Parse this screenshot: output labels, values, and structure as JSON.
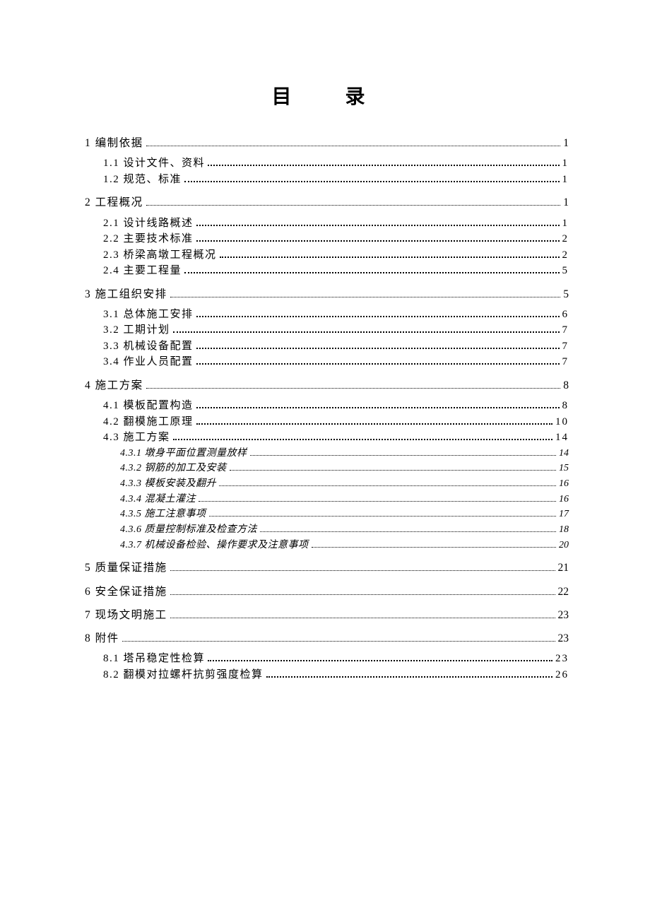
{
  "title": "目　录",
  "toc": [
    {
      "level": 1,
      "label": "1 编制依据",
      "page": "1"
    },
    {
      "level": 2,
      "label": "1.1 设计文件、资料",
      "page": "1"
    },
    {
      "level": 2,
      "label": "1.2 规范、标准",
      "page": "1"
    },
    {
      "level": 1,
      "label": "2 工程概况",
      "page": "1"
    },
    {
      "level": 2,
      "label": "2.1 设计线路概述",
      "page": "1"
    },
    {
      "level": 2,
      "label": "2.2 主要技术标准",
      "page": "2"
    },
    {
      "level": 2,
      "label": "2.3 桥梁高墩工程概况",
      "page": "2"
    },
    {
      "level": 2,
      "label": "2.4 主要工程量",
      "page": "5"
    },
    {
      "level": 1,
      "label": "3 施工组织安排",
      "page": "5"
    },
    {
      "level": 2,
      "label": "3.1 总体施工安排",
      "page": "6"
    },
    {
      "level": 2,
      "label": "3.2 工期计划",
      "page": "7"
    },
    {
      "level": 2,
      "label": "3.3 机械设备配置",
      "page": "7"
    },
    {
      "level": 2,
      "label": "3.4 作业人员配置",
      "page": "7"
    },
    {
      "level": 1,
      "label": "4 施工方案",
      "page": "8"
    },
    {
      "level": 2,
      "label": "4.1 模板配置构造",
      "page": "8"
    },
    {
      "level": 2,
      "label": "4.2 翻模施工原理",
      "page": "10"
    },
    {
      "level": 2,
      "label": "4.3 施工方案",
      "page": "14"
    },
    {
      "level": 3,
      "label": "4.3.1 墩身平面位置测量放样",
      "page": "14"
    },
    {
      "level": 3,
      "label": "4.3.2 钢筋的加工及安装",
      "page": "15"
    },
    {
      "level": 3,
      "label": "4.3.3 模板安装及翻升",
      "page": "16"
    },
    {
      "level": 3,
      "label": "4.3.4 混凝土灌注",
      "page": "16"
    },
    {
      "level": 3,
      "label": "4.3.5 施工注意事项",
      "page": "17"
    },
    {
      "level": 3,
      "label": "4.3.6 质量控制标准及检查方法",
      "page": "18"
    },
    {
      "level": 3,
      "label": "4.3.7 机械设备检验、操作要求及注意事项",
      "page": "20"
    },
    {
      "level": 1,
      "label": "5 质量保证措施",
      "page": "21"
    },
    {
      "level": 1,
      "label": "6 安全保证措施",
      "page": "22"
    },
    {
      "level": 1,
      "label": "7 现场文明施工",
      "page": "23"
    },
    {
      "level": 1,
      "label": "8 附件",
      "page": "23"
    },
    {
      "level": 2,
      "label": "8.1 塔吊稳定性检算",
      "page": "23"
    },
    {
      "level": 2,
      "label": "8.2 翻模对拉螺杆抗剪强度检算",
      "page": "26"
    }
  ]
}
